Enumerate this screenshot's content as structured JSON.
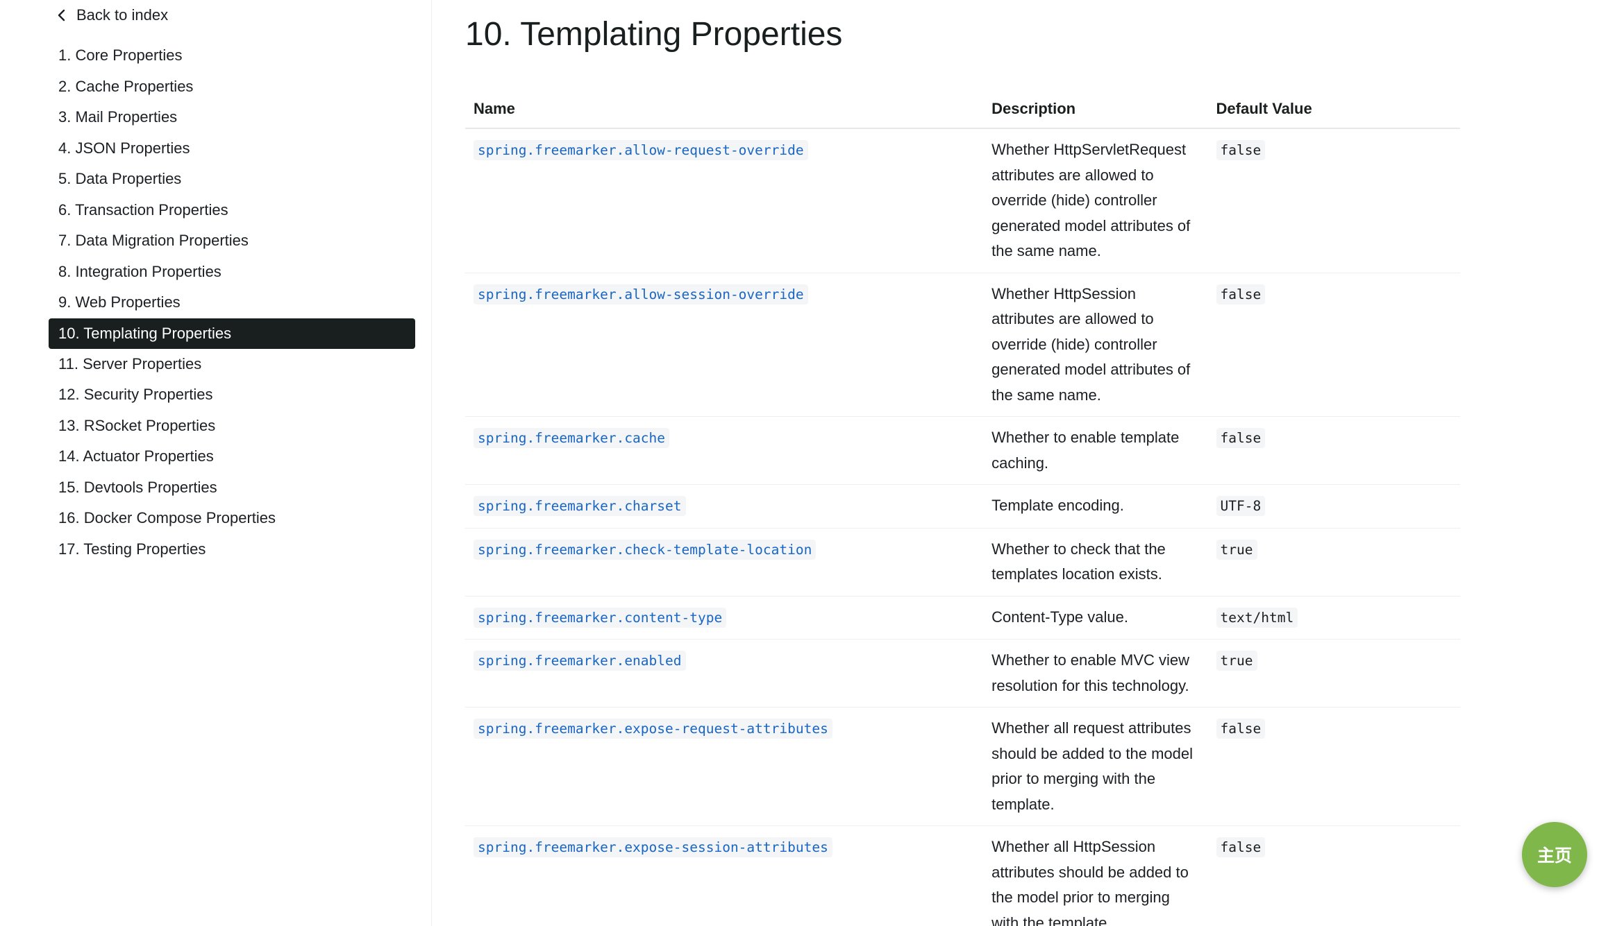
{
  "sidebar": {
    "back_label": "Back to index",
    "items": [
      {
        "label": "1. Core Properties"
      },
      {
        "label": "2. Cache Properties"
      },
      {
        "label": "3. Mail Properties"
      },
      {
        "label": "4. JSON Properties"
      },
      {
        "label": "5. Data Properties"
      },
      {
        "label": "6. Transaction Properties"
      },
      {
        "label": "7. Data Migration Properties"
      },
      {
        "label": "8. Integration Properties"
      },
      {
        "label": "9. Web Properties"
      },
      {
        "label": "10. Templating Properties",
        "active": true
      },
      {
        "label": "11. Server Properties"
      },
      {
        "label": "12. Security Properties"
      },
      {
        "label": "13. RSocket Properties"
      },
      {
        "label": "14. Actuator Properties"
      },
      {
        "label": "15. Devtools Properties"
      },
      {
        "label": "16. Docker Compose Properties"
      },
      {
        "label": "17. Testing Properties"
      }
    ]
  },
  "main": {
    "title": "10. Templating Properties",
    "table": {
      "headers": {
        "name": "Name",
        "description": "Description",
        "default": "Default Value"
      },
      "rows": [
        {
          "name": "spring.freemarker.allow-request-override",
          "description": "Whether HttpServletRequest attributes are allowed to override (hide) controller generated model attributes of the same name.",
          "default": "false"
        },
        {
          "name": "spring.freemarker.allow-session-override",
          "description": "Whether HttpSession attributes are allowed to override (hide) controller generated model attributes of the same name.",
          "default": "false"
        },
        {
          "name": "spring.freemarker.cache",
          "description": "Whether to enable template caching.",
          "default": "false"
        },
        {
          "name": "spring.freemarker.charset",
          "description": "Template encoding.",
          "default": "UTF-8"
        },
        {
          "name": "spring.freemarker.check-template-location",
          "description": "Whether to check that the templates location exists.",
          "default": "true"
        },
        {
          "name": "spring.freemarker.content-type",
          "description": "Content-Type value.",
          "default": "text/html"
        },
        {
          "name": "spring.freemarker.enabled",
          "description": "Whether to enable MVC view resolution for this technology.",
          "default": "true"
        },
        {
          "name": "spring.freemarker.expose-request-attributes",
          "description": "Whether all request attributes should be added to the model prior to merging with the template.",
          "default": "false"
        },
        {
          "name": "spring.freemarker.expose-session-attributes",
          "description": "Whether all HttpSession attributes should be added to the model prior to merging with the template.",
          "default": "false"
        }
      ]
    }
  },
  "fab": {
    "label": "主页",
    "color": "#7fb74a"
  },
  "colors": {
    "active_nav_bg": "#191e1e",
    "property_link": "#1a66c4"
  },
  "icons": {
    "back": "chevron-left-icon"
  }
}
